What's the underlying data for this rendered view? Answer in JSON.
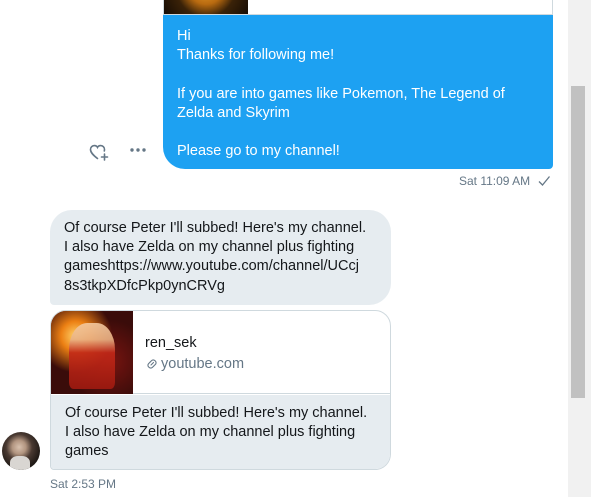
{
  "outgoing_message": {
    "lines": [
      "Hi",
      "Thanks for following me!",
      "",
      "If you are into games like Pokemon, The Legend of",
      "Zelda and Skyrim",
      "",
      "Please go to my channel!"
    ],
    "timestamp": "Sat 11:09 AM"
  },
  "incoming_message": {
    "lines": [
      "Of course Peter I'll subbed! Here's my channel.",
      "I also have Zelda on my channel plus fighting",
      "gameshttps://www.youtube.com/channel/UCcj",
      "8s3tkpXDfcPkp0ynCRVg"
    ],
    "link_card": {
      "title": "ren_sek",
      "domain": "youtube.com",
      "description_lines": [
        "Of course Peter I'll subbed! Here's my channel.",
        "I also have Zelda on my channel plus fighting",
        "games"
      ]
    },
    "timestamp": "Sat 2:53 PM"
  },
  "colors": {
    "outgoing_bubble": "#1da1f2",
    "incoming_bubble": "#e6ecf0",
    "meta_text": "#657786",
    "accent": "#1da1f2"
  },
  "icons": {
    "react": "heart-plus-icon",
    "more": "more-horizontal-icon",
    "sent": "checkmark-icon",
    "link": "link-icon"
  }
}
